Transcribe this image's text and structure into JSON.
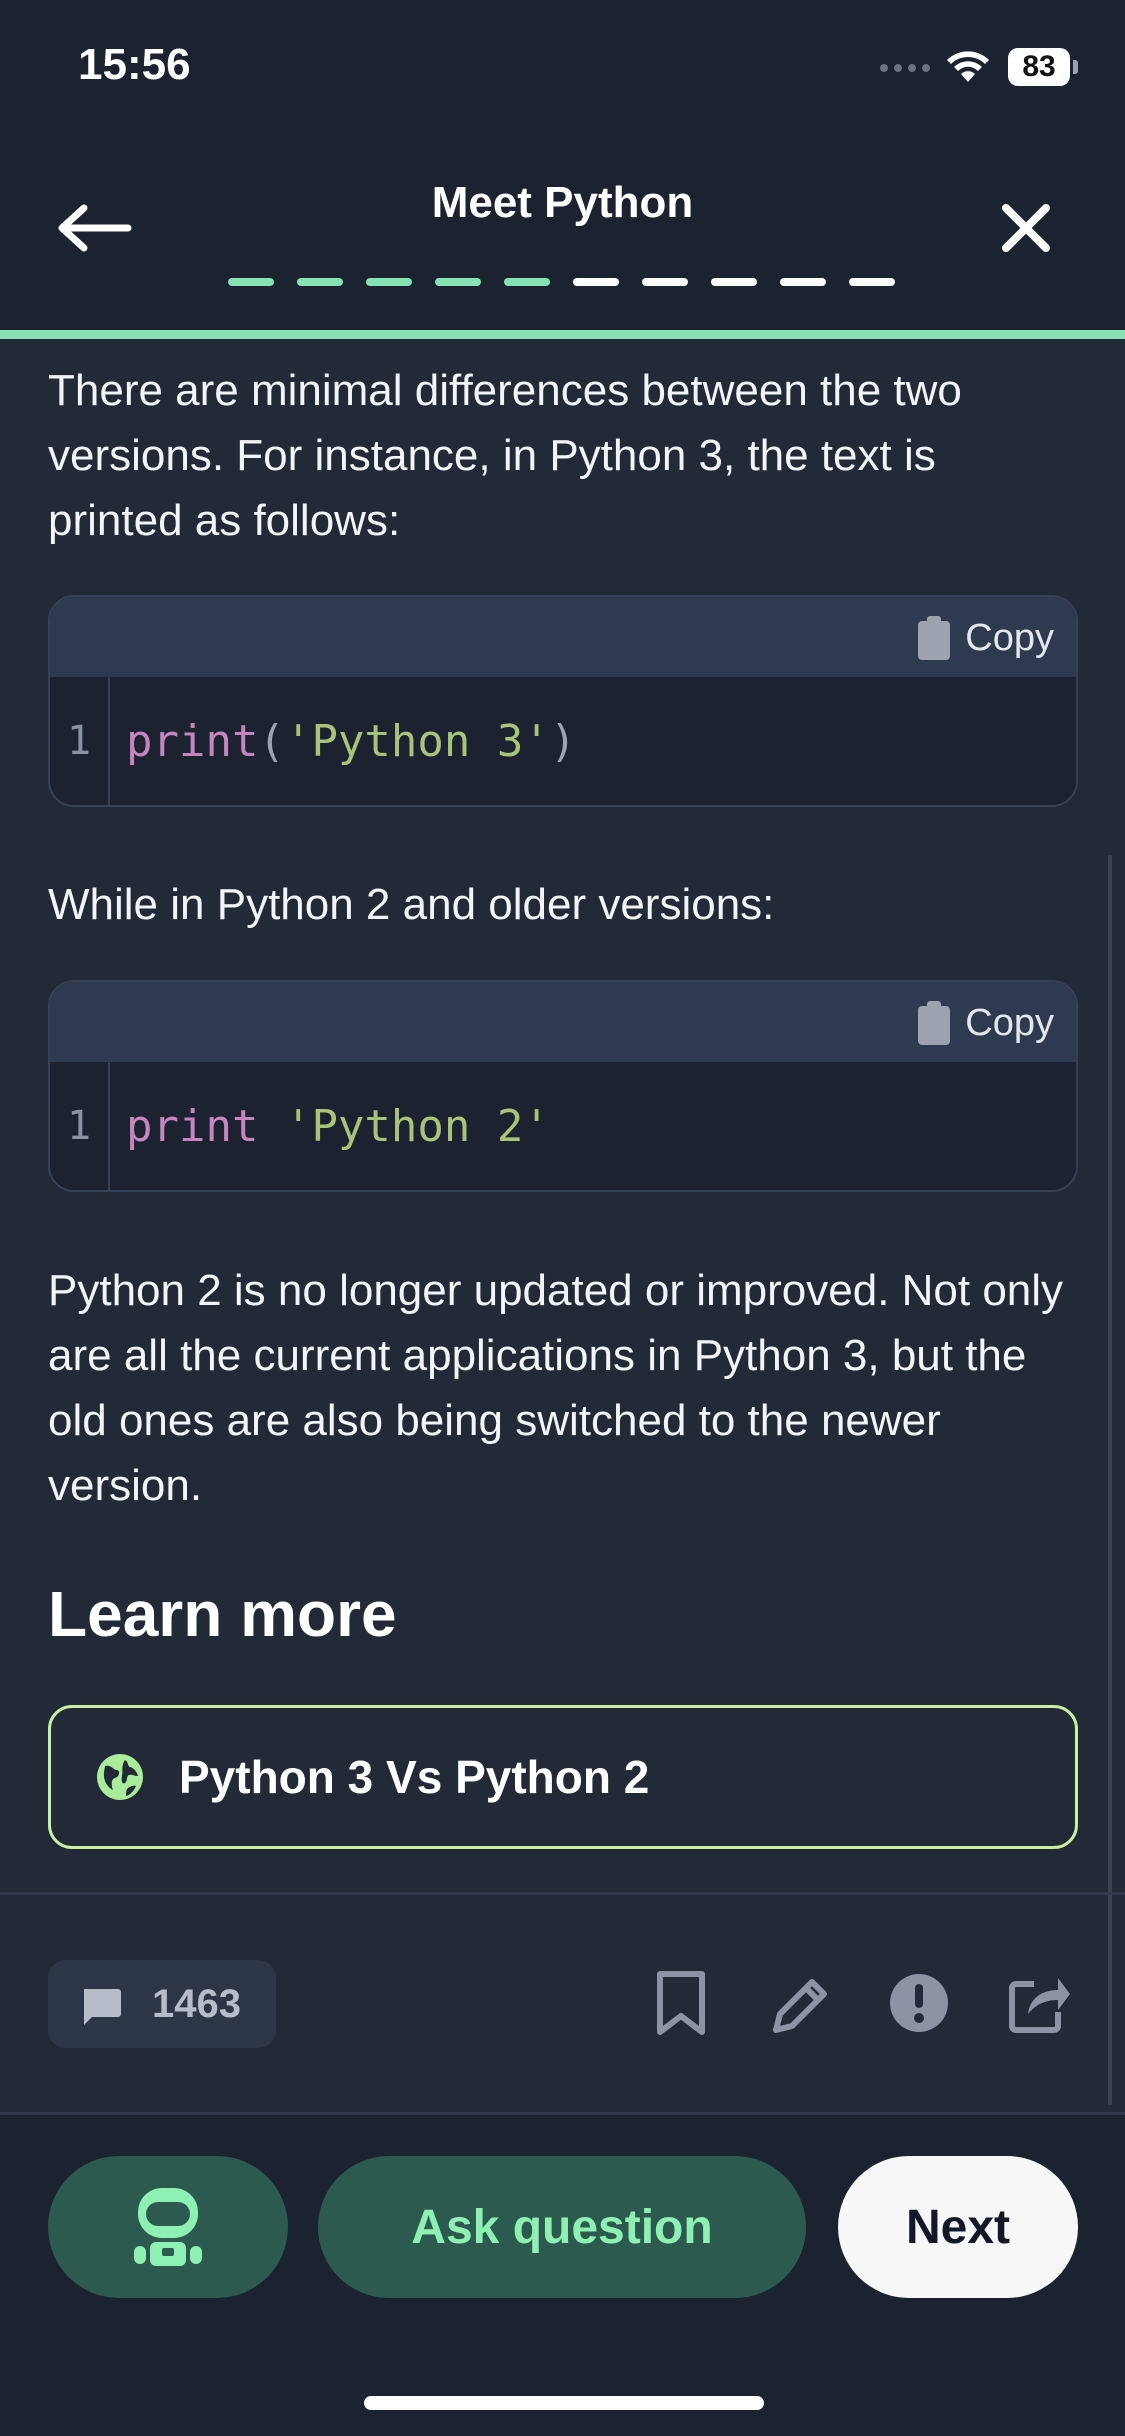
{
  "status_bar": {
    "time": "15:56",
    "battery": "83"
  },
  "header": {
    "title": "Meet Python",
    "progress": {
      "total": 10,
      "completed": 5
    },
    "colors": {
      "done": "#86e2b4",
      "todo": "#ffffff"
    }
  },
  "content": {
    "paragraph1": "There are minimal differences between the two versions. For instance, in Python 3, the text is printed as follows:",
    "code1": {
      "copy_label": "Copy",
      "line_number": "1",
      "tokens": [
        {
          "text": "print",
          "kind": "kw"
        },
        {
          "text": "(",
          "kind": "punc"
        },
        {
          "text": "'Python 3'",
          "kind": "str"
        },
        {
          "text": ")",
          "kind": "punc"
        }
      ]
    },
    "paragraph2": "While in Python 2 and older versions:",
    "code2": {
      "copy_label": "Copy",
      "line_number": "1",
      "tokens": [
        {
          "text": "print",
          "kind": "kw"
        },
        {
          "text": " ",
          "kind": "punc"
        },
        {
          "text": "'Python 2'",
          "kind": "str"
        }
      ]
    },
    "paragraph3": "Python 2 is no longer updated or improved. Not only are all the current applications in Python 3, but the old ones are also being switched to the newer version.",
    "learn_more": {
      "heading": "Learn more",
      "link_label": "Python 3 Vs Python 2",
      "link_icon": "globe-icon"
    }
  },
  "actions": {
    "comment_count": "1463",
    "icons": [
      "bookmark-icon",
      "pencil-icon",
      "report-icon",
      "share-icon"
    ]
  },
  "bottom": {
    "ask_label": "Ask question",
    "next_label": "Next",
    "robot_icon": "robot-icon"
  },
  "colors": {
    "accent": "#86e2b4",
    "background": "#222937",
    "header": "#1b2230"
  }
}
